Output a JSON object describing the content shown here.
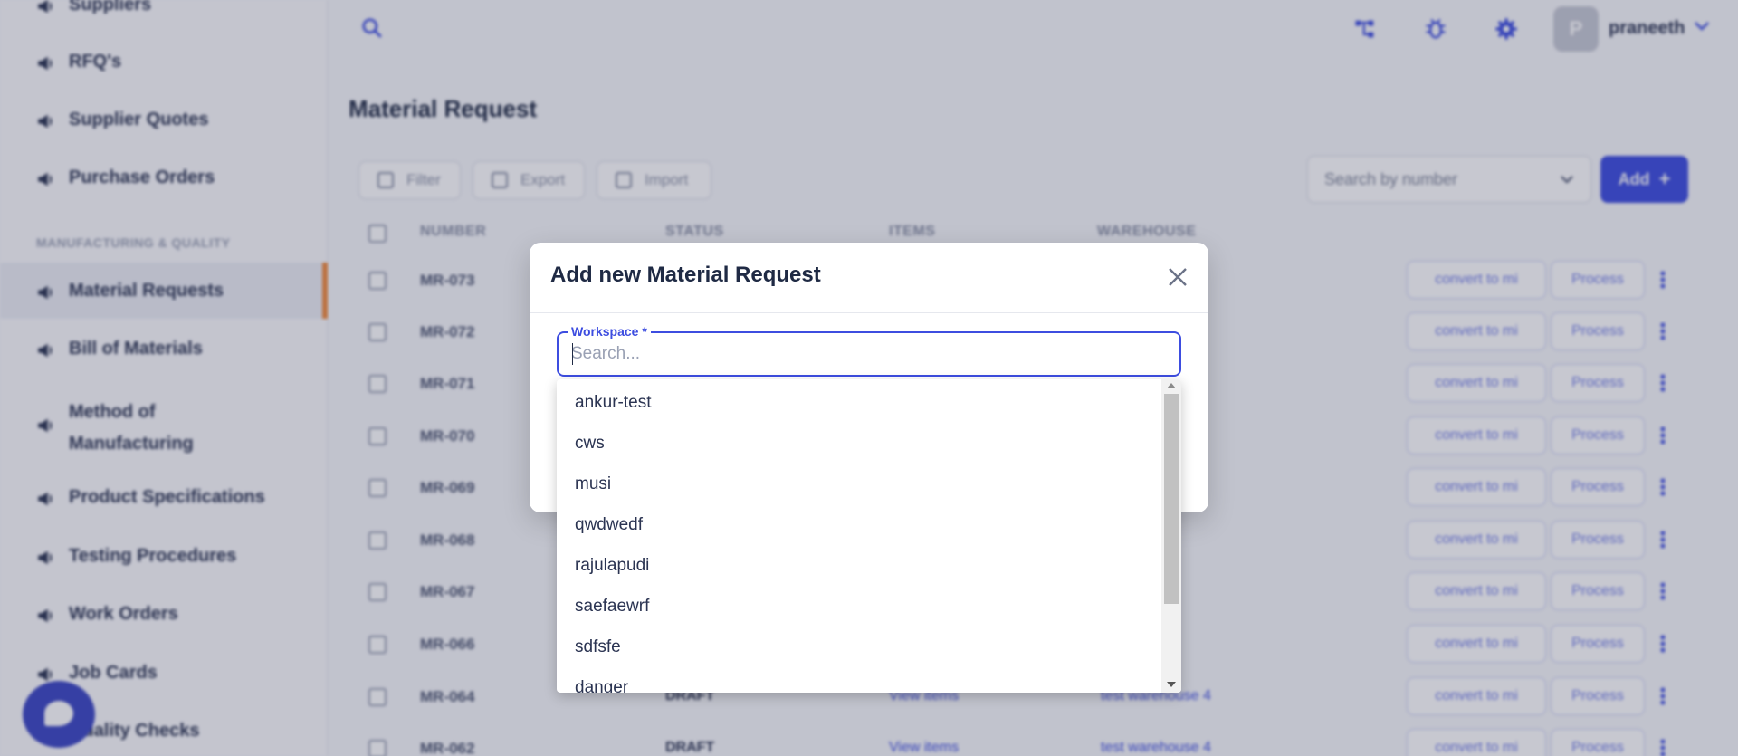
{
  "sidebar": {
    "items_top": [
      "Suppliers",
      "RFQ's",
      "Supplier Quotes",
      "Purchase Orders"
    ],
    "section_label": "MANUFACTURING & QUALITY",
    "items": [
      "Material Requests",
      "Bill of Materials",
      "Method of Manufacturing",
      "Product Specifications",
      "Testing Procedures",
      "Work Orders",
      "Job Cards",
      "Quality Checks"
    ],
    "active_item": "Material Requests"
  },
  "header": {
    "username": "praneeth",
    "avatar_initial": "P",
    "icons": [
      "search-icon",
      "hierarchy-icon",
      "bug-icon",
      "gear-icon",
      "chevron-down-icon"
    ]
  },
  "page": {
    "title": "Material Request",
    "toolbar": {
      "filter": "Filter",
      "export": "Export",
      "import": "Import",
      "search_placeholder": "Search by number",
      "add": "Add"
    }
  },
  "table": {
    "columns": [
      "NUMBER",
      "STATUS",
      "ITEMS",
      "WAREHOUSE"
    ],
    "rows": [
      "MR-073",
      "MR-072",
      "MR-071",
      "MR-070",
      "MR-069",
      "MR-068",
      "MR-067",
      "MR-066",
      "MR-064",
      "MR-062"
    ],
    "row_status_visible": [
      "DRAFT",
      "DRAFT"
    ],
    "row_items_visible": [
      "View items",
      "View items"
    ],
    "row_warehouse_visible": [
      "test warehouse 4",
      "test warehouse 4"
    ],
    "row_actions": {
      "convert": "convert to mi",
      "process": "Process"
    }
  },
  "modal": {
    "title": "Add new Material Request",
    "field_label": "Workspace *",
    "field_placeholder": "Search...",
    "options": [
      "ankur-test",
      "cws",
      "musi",
      "qwdwedf",
      "rajulapudi",
      "saefaewrf",
      "sdfsfe",
      "danger"
    ]
  },
  "colors": {
    "primary": "#3d4de0",
    "accent_orange": "#f08a3c",
    "text_dark": "#1f2a44"
  }
}
